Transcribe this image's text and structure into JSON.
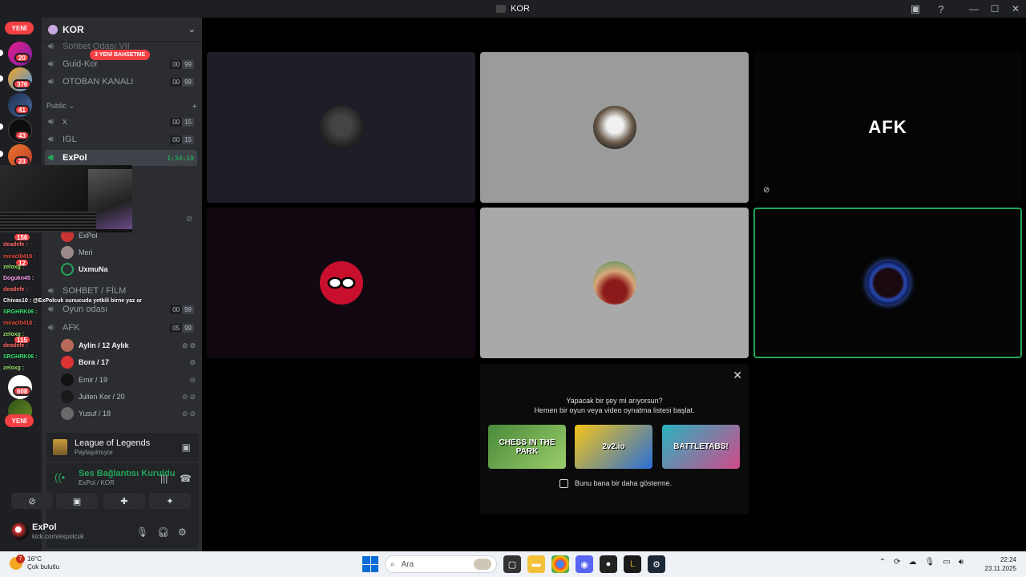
{
  "window": {
    "title": "KOR"
  },
  "rail": {
    "new_top": "YENİ",
    "new_bottom": "YENİ",
    "badges": [
      "20",
      "376",
      "41",
      "43",
      "23",
      "156",
      "12",
      "115",
      "608"
    ]
  },
  "server": {
    "name": "KOR"
  },
  "mention_pill": "3 YENİ BAHSETME",
  "channels": {
    "top": [
      {
        "name": "Sohbet Odası VII"
      },
      {
        "name": "Guid-Kor",
        "a": "00",
        "b": "99"
      },
      {
        "name": "OTOBAN KANALI",
        "a": "00",
        "b": "99"
      }
    ],
    "public_category": "Public",
    "public": [
      {
        "name": "x",
        "a": "00",
        "b": "15"
      },
      {
        "name": "IGL",
        "a": "00",
        "b": "15"
      },
      {
        "name": "ExPol",
        "timer": "1:34:19"
      }
    ],
    "expol_users": [
      "ExPol",
      "Meri",
      "UxmuNa"
    ],
    "sohbet_category": "SOHBET / FİLM",
    "lower": [
      {
        "name": "Oyun odası",
        "a": "00",
        "b": "99"
      },
      {
        "name": "AFK",
        "a": "05",
        "b": "99"
      }
    ],
    "afk_users": [
      "Aylin / 12 Aylık",
      "Bora / 17",
      "Emir / 19",
      "Julien Kor / 20",
      "Yusuf / 18"
    ]
  },
  "chat_overlay": [
    "deadefe :",
    "miracl0418 :",
    "zeloxg :",
    "Dogukn45 :",
    "deadefe :",
    "Chivas10 : @ExPolcuk sunucuda yetkili birne yaz ar",
    "SRGHRK06 :",
    "miracl0418 :",
    "zeloxg :",
    "deadefe :",
    "SRGHRK06 :",
    "zeloxg :"
  ],
  "activity": {
    "game": "League of Legends",
    "sub": "Paylaşılmıyor"
  },
  "voice": {
    "status": "Ses Bağlantısı Kuruldu",
    "location": "ExPol / KOR"
  },
  "user": {
    "name": "ExPol",
    "status": "kick.com/expolcuk"
  },
  "tiles": {
    "afk_label": "AFK"
  },
  "activity_panel": {
    "heading": "Yapacak bir şey mi arıyorsun?",
    "subheading": "Hemen bir oyun veya video oynatma listesi başlat.",
    "games": [
      "CHESS IN THE PARK",
      "2v2.io",
      "BATTLETABS!"
    ],
    "checkbox_label": "Bunu bana bir daha gösterme."
  },
  "taskbar": {
    "temp": "16°C",
    "weather": "Çok bulutlu",
    "weather_alert": "7",
    "search_placeholder": "Ara",
    "time": "22:24",
    "date": "23.11.2025"
  },
  "colors": {
    "accent_green": "#23a55a",
    "mention_red": "#f23f43",
    "sidebar_bg": "#2b2d31"
  }
}
